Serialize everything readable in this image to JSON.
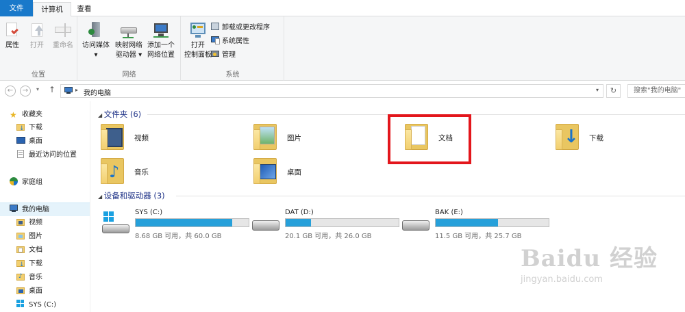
{
  "tabs": [
    {
      "label": "文件"
    },
    {
      "label": "计算机"
    },
    {
      "label": "查看"
    }
  ],
  "ribbon": {
    "location_group": {
      "label": "位置",
      "properties": "属性",
      "open": "打开",
      "rename": "重命名"
    },
    "network_group": {
      "label": "网络",
      "access_media_1": "访问媒体",
      "map_drive_1": "映射网络",
      "map_drive_2": "驱动器",
      "add_location_1": "添加一个",
      "add_location_2": "网络位置"
    },
    "system_group": {
      "label": "系统",
      "open_cp_1": "打开",
      "open_cp_2": "控制面板",
      "uninstall": "卸载或更改程序",
      "sys_props": "系统属性",
      "manage": "管理"
    }
  },
  "address": {
    "path": "我的电脑",
    "search_placeholder": "搜索\"我的电脑\""
  },
  "navpane": {
    "favorites": "收藏夹",
    "fav_downloads": "下载",
    "fav_desktop": "桌面",
    "fav_recent": "最近访问的位置",
    "homegroup": "家庭组",
    "this_pc": "我的电脑",
    "pc_videos": "视频",
    "pc_pictures": "图片",
    "pc_documents": "文档",
    "pc_downloads": "下载",
    "pc_music": "音乐",
    "pc_desktop": "桌面",
    "pc_sys": "SYS (C:)"
  },
  "folders_header": "文件夹 (6)",
  "folders": [
    {
      "name": "视频"
    },
    {
      "name": "图片"
    },
    {
      "name": "文档"
    },
    {
      "name": "下载"
    },
    {
      "name": "音乐"
    },
    {
      "name": "桌面"
    }
  ],
  "drives_header": "设备和驱动器 (3)",
  "drives": [
    {
      "name": "SYS (C:)",
      "free_text": "8.68 GB 可用，共 60.0 GB",
      "used_fraction": 0.855
    },
    {
      "name": "DAT (D:)",
      "free_text": "20.1 GB 可用，共 26.0 GB",
      "used_fraction": 0.227
    },
    {
      "name": "BAK (E:)",
      "free_text": "11.5 GB 可用，共 25.7 GB",
      "used_fraction": 0.553
    }
  ],
  "watermark": {
    "logo": "Baidu 经验",
    "url": "jingyan.baidu.com"
  },
  "colors": {
    "accent": "#1979ca",
    "drive_fill": "#26a0da",
    "highlight": "#e3161c",
    "section_header": "#1e3287"
  }
}
